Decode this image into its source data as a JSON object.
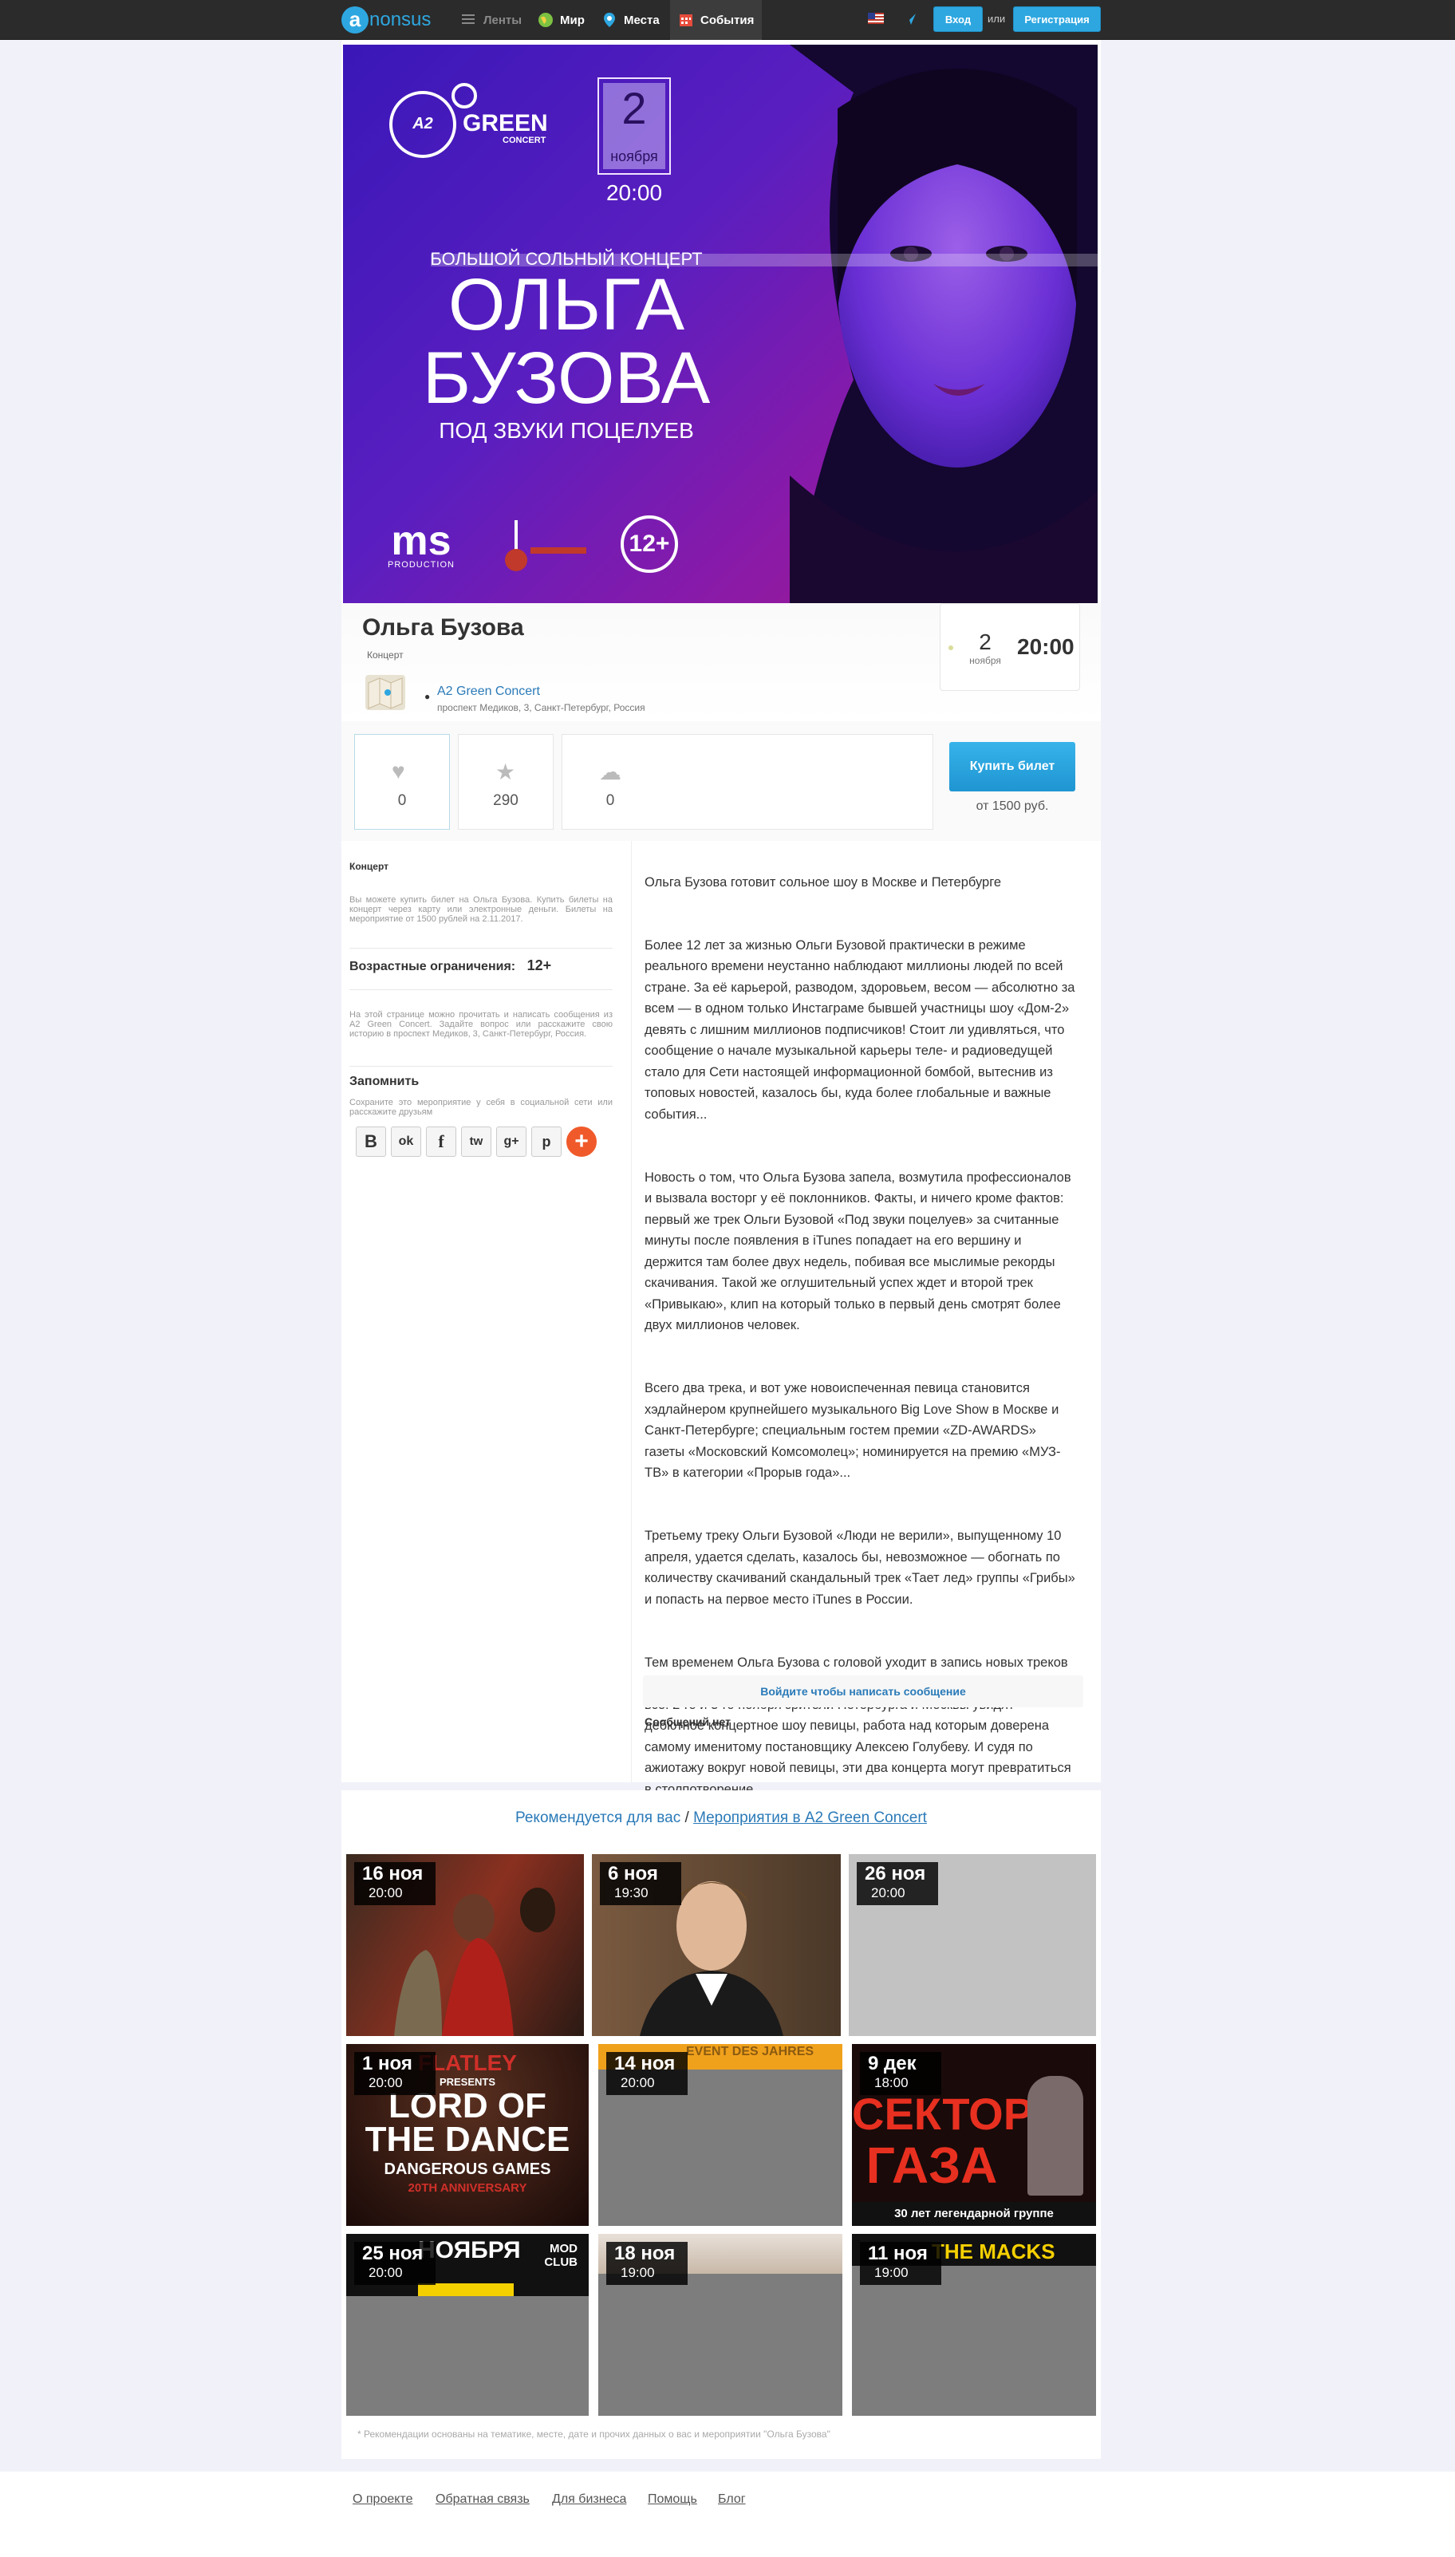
{
  "topbar": {
    "logo_letter": "a",
    "logo_text": "nonsus",
    "nav": [
      {
        "label": "Ленты"
      },
      {
        "label": "Мир"
      },
      {
        "label": "Места"
      },
      {
        "label": "События"
      }
    ],
    "login_label": "Вход",
    "or_label": "или",
    "register_label": "Регистрация"
  },
  "poster": {
    "venue_logo_a2": "A2",
    "venue_logo_green": "GREEN",
    "venue_logo_concert": "CONCERT",
    "date_day": "2",
    "date_month": "ноября",
    "time": "20:00",
    "subtitle": "БОЛЬШОЙ СОЛЬНЫЙ КОНЦЕРТ",
    "name_line1": "ОЛЬГА",
    "name_line2": "БУЗОВА",
    "tagline": "ПОД ЗВУКИ ПОЦЕЛУЕВ",
    "sponsor1": "MS",
    "sponsor1_sub": "PRODUCTION",
    "age": "12+"
  },
  "event": {
    "title": "Ольга Бузова",
    "category": "Концерт",
    "venue_name": "A2 Green Concert",
    "venue_address": "проспект Медиков, 3, Санкт-Петербург, Россия",
    "date_day": "2",
    "date_month": "ноября",
    "time": "20:00"
  },
  "stats": {
    "likes": "0",
    "stars": "290",
    "comments": "0"
  },
  "ticket": {
    "button_label": "Купить билет",
    "price": "от 1500 руб."
  },
  "sidebar": {
    "category": "Концерт",
    "buy_text": "Вы можете купить билет на Ольга Бузова. Купить билеты на концерт через карту или электронные деньги. Билеты на мероприятие от 1500 рублей на 2.11.2017.",
    "age_label": "Возрастные ограничения:",
    "age_value": "12+",
    "info_text": "На этой странице можно прочитать и написать сообщения из A2 Green Concert. Задайте вопрос или расскажите свою историю в проспект Медиков, 3, Санкт-Петербург, Россия.",
    "remember_title": "Запомнить",
    "remember_text": "Сохраните это мероприятие у себя в социальной сети или расскажите друзьям",
    "share_icons": [
      "В",
      "ok",
      "f",
      "tw",
      "g+",
      "p",
      "+"
    ]
  },
  "description": [
    "Ольга Бузова готовит сольное шоу в Москве и Петербурге",
    "Более 12 лет за жизнью Ольги Бузовой практически в режиме реального времени неустанно наблюдают миллионы людей по всей стране. За её карьерой, разводом, здоровьем, весом — абсолютно за всем — в одном только Инстаграме бывшей участницы шоу «Дом-2» девять с лишним миллионов подписчиков! Стоит ли удивляться, что сообщение о начале музыкальной карьеры теле- и радиоведущей стало для Сети настоящей информационной бомбой, вытеснив из топовых новостей, казалось бы, куда более глобальные и важные события...",
    "Новость о том, что Ольга Бузова запела, возмутила профессионалов и вызвала восторг у её поклонников. Факты, и ничего кроме фактов: первый же трек Ольги Бузовой «Под звуки поцелуев» за считанные минуты после появления в iTunes попадает на его вершину и держится там более двух недель, побивая все мыслимые рекорды скачивания. Такой же оглушительный успех ждет и второй трек «Привыкаю», клип на который только в первый день смотрят более двух миллионов человек.",
    "Всего два трека, и вот уже новоиспеченная певица становится хэдлайнером крупнейшего музыкального Big Love Show в Москве и Санкт-Петербурге; специальным гостем премии «ZD-AWARDS» газеты «Московский Комсомолец»; номинируется на премию «МУЗ-ТВ» в категории «Прорыв года»...",
    "Третьему треку Ольги Бузовой «Люди не верили», выпущенному 10 апреля, удается сделать, казалось бы, невозможное — обогнать по количеству скачиваний скандальный трек «Тает лед» группы «Грибы» и попасть на первое место iTunes в России.",
    "Тем временем Ольга Бузова с головой уходит в запись новых треков и обещает к сентябрю выпустить первый альбом. Но и это еще не всё! 2-го и 3-го ноября зрители Петербурга и Москвы увидят дебютное концертное шоу певицы, работа над которым доверена самому именитому постановщику Алексею Голубеву. И судя по ажиотажу вокруг новой певицы, эти два концерта могут превратиться в столпотворение..."
  ],
  "comments": {
    "login_prompt": "Войдите чтобы написать сообщение",
    "empty": "Сообщений нет"
  },
  "recommendations": {
    "title_prefix": "Рекомендуется для вас",
    "separator": "/",
    "title_link": "Мероприятия в A2 Green Concert",
    "cards": [
      {
        "date": "16 ноя",
        "time": "20:00"
      },
      {
        "date": "6 ноя",
        "time": "19:30"
      },
      {
        "date": "26 ноя",
        "time": "20:00"
      },
      {
        "date": "1 ноя",
        "time": "20:00",
        "poster_top": "FLATLEY",
        "poster_presents": "PRESENTS",
        "poster_title1": "LORD OF",
        "poster_title2": "THE DANCE",
        "poster_sub": "DANGEROUS GAMES",
        "poster_anniv": "20TH ANNIVERSARY"
      },
      {
        "date": "14 ноя",
        "time": "20:00",
        "poster_top": "EVENT DES JAHRES"
      },
      {
        "date": "9 дек",
        "time": "18:00",
        "poster_title1": "СЕКТОР",
        "poster_title2": "ГАЗА",
        "poster_sub": "30 лет легендарной группе"
      },
      {
        "date": "25 ноя",
        "time": "20:00",
        "poster_top": "НОЯБРЯ",
        "poster_club": "MOD CLUB"
      },
      {
        "date": "18 ноя",
        "time": "19:00"
      },
      {
        "date": "11 ноя",
        "time": "19:00",
        "poster_top": "THE MACKS"
      }
    ],
    "note": "* Рекомендации основаны на тематике, месте, дате и прочих данных о вас и мероприятии \"Ольга Бузова\""
  },
  "footer": {
    "links": [
      "О проекте",
      "Обратная связь",
      "Для бизнеса",
      "Помощь",
      "Блог"
    ]
  },
  "colors": {
    "accent": "#2ea7e0",
    "topbar": "#2b2b2b",
    "page_bg": "#f1f2f9"
  }
}
